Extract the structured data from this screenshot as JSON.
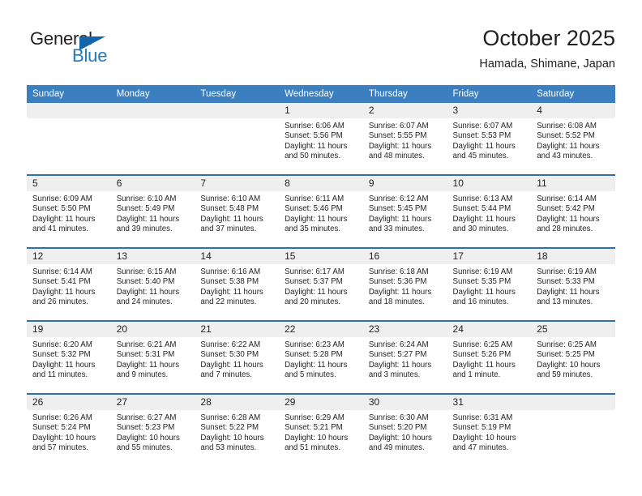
{
  "brand": {
    "name_part1": "General",
    "name_part2": "Blue",
    "triangle_color": "#1565a8",
    "blue_color": "#1f7bc1"
  },
  "header": {
    "title": "October 2025",
    "subtitle": "Hamada, Shimane, Japan",
    "accent_color": "#3c7fc0",
    "separator_color": "#2f6fae",
    "daynum_bg": "#efefef"
  },
  "weekday_headers": [
    "Sunday",
    "Monday",
    "Tuesday",
    "Wednesday",
    "Thursday",
    "Friday",
    "Saturday"
  ],
  "labels": {
    "sunrise": "Sunrise:",
    "sunset": "Sunset:",
    "daylight": "Daylight:"
  },
  "weeks": [
    [
      {
        "day": "",
        "line1": "",
        "line2": "",
        "line3": "",
        "line4": "",
        "blank": true
      },
      {
        "day": "",
        "line1": "",
        "line2": "",
        "line3": "",
        "line4": "",
        "blank": true
      },
      {
        "day": "",
        "line1": "",
        "line2": "",
        "line3": "",
        "line4": "",
        "blank": true
      },
      {
        "day": "1",
        "line1": "Sunrise: 6:06 AM",
        "line2": "Sunset: 5:56 PM",
        "line3": "Daylight: 11 hours",
        "line4": "and 50 minutes.",
        "blank": false
      },
      {
        "day": "2",
        "line1": "Sunrise: 6:07 AM",
        "line2": "Sunset: 5:55 PM",
        "line3": "Daylight: 11 hours",
        "line4": "and 48 minutes.",
        "blank": false
      },
      {
        "day": "3",
        "line1": "Sunrise: 6:07 AM",
        "line2": "Sunset: 5:53 PM",
        "line3": "Daylight: 11 hours",
        "line4": "and 45 minutes.",
        "blank": false
      },
      {
        "day": "4",
        "line1": "Sunrise: 6:08 AM",
        "line2": "Sunset: 5:52 PM",
        "line3": "Daylight: 11 hours",
        "line4": "and 43 minutes.",
        "blank": false
      }
    ],
    [
      {
        "day": "5",
        "line1": "Sunrise: 6:09 AM",
        "line2": "Sunset: 5:50 PM",
        "line3": "Daylight: 11 hours",
        "line4": "and 41 minutes.",
        "blank": false
      },
      {
        "day": "6",
        "line1": "Sunrise: 6:10 AM",
        "line2": "Sunset: 5:49 PM",
        "line3": "Daylight: 11 hours",
        "line4": "and 39 minutes.",
        "blank": false
      },
      {
        "day": "7",
        "line1": "Sunrise: 6:10 AM",
        "line2": "Sunset: 5:48 PM",
        "line3": "Daylight: 11 hours",
        "line4": "and 37 minutes.",
        "blank": false
      },
      {
        "day": "8",
        "line1": "Sunrise: 6:11 AM",
        "line2": "Sunset: 5:46 PM",
        "line3": "Daylight: 11 hours",
        "line4": "and 35 minutes.",
        "blank": false
      },
      {
        "day": "9",
        "line1": "Sunrise: 6:12 AM",
        "line2": "Sunset: 5:45 PM",
        "line3": "Daylight: 11 hours",
        "line4": "and 33 minutes.",
        "blank": false
      },
      {
        "day": "10",
        "line1": "Sunrise: 6:13 AM",
        "line2": "Sunset: 5:44 PM",
        "line3": "Daylight: 11 hours",
        "line4": "and 30 minutes.",
        "blank": false
      },
      {
        "day": "11",
        "line1": "Sunrise: 6:14 AM",
        "line2": "Sunset: 5:42 PM",
        "line3": "Daylight: 11 hours",
        "line4": "and 28 minutes.",
        "blank": false
      }
    ],
    [
      {
        "day": "12",
        "line1": "Sunrise: 6:14 AM",
        "line2": "Sunset: 5:41 PM",
        "line3": "Daylight: 11 hours",
        "line4": "and 26 minutes.",
        "blank": false
      },
      {
        "day": "13",
        "line1": "Sunrise: 6:15 AM",
        "line2": "Sunset: 5:40 PM",
        "line3": "Daylight: 11 hours",
        "line4": "and 24 minutes.",
        "blank": false
      },
      {
        "day": "14",
        "line1": "Sunrise: 6:16 AM",
        "line2": "Sunset: 5:38 PM",
        "line3": "Daylight: 11 hours",
        "line4": "and 22 minutes.",
        "blank": false
      },
      {
        "day": "15",
        "line1": "Sunrise: 6:17 AM",
        "line2": "Sunset: 5:37 PM",
        "line3": "Daylight: 11 hours",
        "line4": "and 20 minutes.",
        "blank": false
      },
      {
        "day": "16",
        "line1": "Sunrise: 6:18 AM",
        "line2": "Sunset: 5:36 PM",
        "line3": "Daylight: 11 hours",
        "line4": "and 18 minutes.",
        "blank": false
      },
      {
        "day": "17",
        "line1": "Sunrise: 6:19 AM",
        "line2": "Sunset: 5:35 PM",
        "line3": "Daylight: 11 hours",
        "line4": "and 16 minutes.",
        "blank": false
      },
      {
        "day": "18",
        "line1": "Sunrise: 6:19 AM",
        "line2": "Sunset: 5:33 PM",
        "line3": "Daylight: 11 hours",
        "line4": "and 13 minutes.",
        "blank": false
      }
    ],
    [
      {
        "day": "19",
        "line1": "Sunrise: 6:20 AM",
        "line2": "Sunset: 5:32 PM",
        "line3": "Daylight: 11 hours",
        "line4": "and 11 minutes.",
        "blank": false
      },
      {
        "day": "20",
        "line1": "Sunrise: 6:21 AM",
        "line2": "Sunset: 5:31 PM",
        "line3": "Daylight: 11 hours",
        "line4": "and 9 minutes.",
        "blank": false
      },
      {
        "day": "21",
        "line1": "Sunrise: 6:22 AM",
        "line2": "Sunset: 5:30 PM",
        "line3": "Daylight: 11 hours",
        "line4": "and 7 minutes.",
        "blank": false
      },
      {
        "day": "22",
        "line1": "Sunrise: 6:23 AM",
        "line2": "Sunset: 5:28 PM",
        "line3": "Daylight: 11 hours",
        "line4": "and 5 minutes.",
        "blank": false
      },
      {
        "day": "23",
        "line1": "Sunrise: 6:24 AM",
        "line2": "Sunset: 5:27 PM",
        "line3": "Daylight: 11 hours",
        "line4": "and 3 minutes.",
        "blank": false
      },
      {
        "day": "24",
        "line1": "Sunrise: 6:25 AM",
        "line2": "Sunset: 5:26 PM",
        "line3": "Daylight: 11 hours",
        "line4": "and 1 minute.",
        "blank": false
      },
      {
        "day": "25",
        "line1": "Sunrise: 6:25 AM",
        "line2": "Sunset: 5:25 PM",
        "line3": "Daylight: 10 hours",
        "line4": "and 59 minutes.",
        "blank": false
      }
    ],
    [
      {
        "day": "26",
        "line1": "Sunrise: 6:26 AM",
        "line2": "Sunset: 5:24 PM",
        "line3": "Daylight: 10 hours",
        "line4": "and 57 minutes.",
        "blank": false
      },
      {
        "day": "27",
        "line1": "Sunrise: 6:27 AM",
        "line2": "Sunset: 5:23 PM",
        "line3": "Daylight: 10 hours",
        "line4": "and 55 minutes.",
        "blank": false
      },
      {
        "day": "28",
        "line1": "Sunrise: 6:28 AM",
        "line2": "Sunset: 5:22 PM",
        "line3": "Daylight: 10 hours",
        "line4": "and 53 minutes.",
        "blank": false
      },
      {
        "day": "29",
        "line1": "Sunrise: 6:29 AM",
        "line2": "Sunset: 5:21 PM",
        "line3": "Daylight: 10 hours",
        "line4": "and 51 minutes.",
        "blank": false
      },
      {
        "day": "30",
        "line1": "Sunrise: 6:30 AM",
        "line2": "Sunset: 5:20 PM",
        "line3": "Daylight: 10 hours",
        "line4": "and 49 minutes.",
        "blank": false
      },
      {
        "day": "31",
        "line1": "Sunrise: 6:31 AM",
        "line2": "Sunset: 5:19 PM",
        "line3": "Daylight: 10 hours",
        "line4": "and 47 minutes.",
        "blank": false
      },
      {
        "day": "",
        "line1": "",
        "line2": "",
        "line3": "",
        "line4": "",
        "blank": true
      }
    ]
  ]
}
